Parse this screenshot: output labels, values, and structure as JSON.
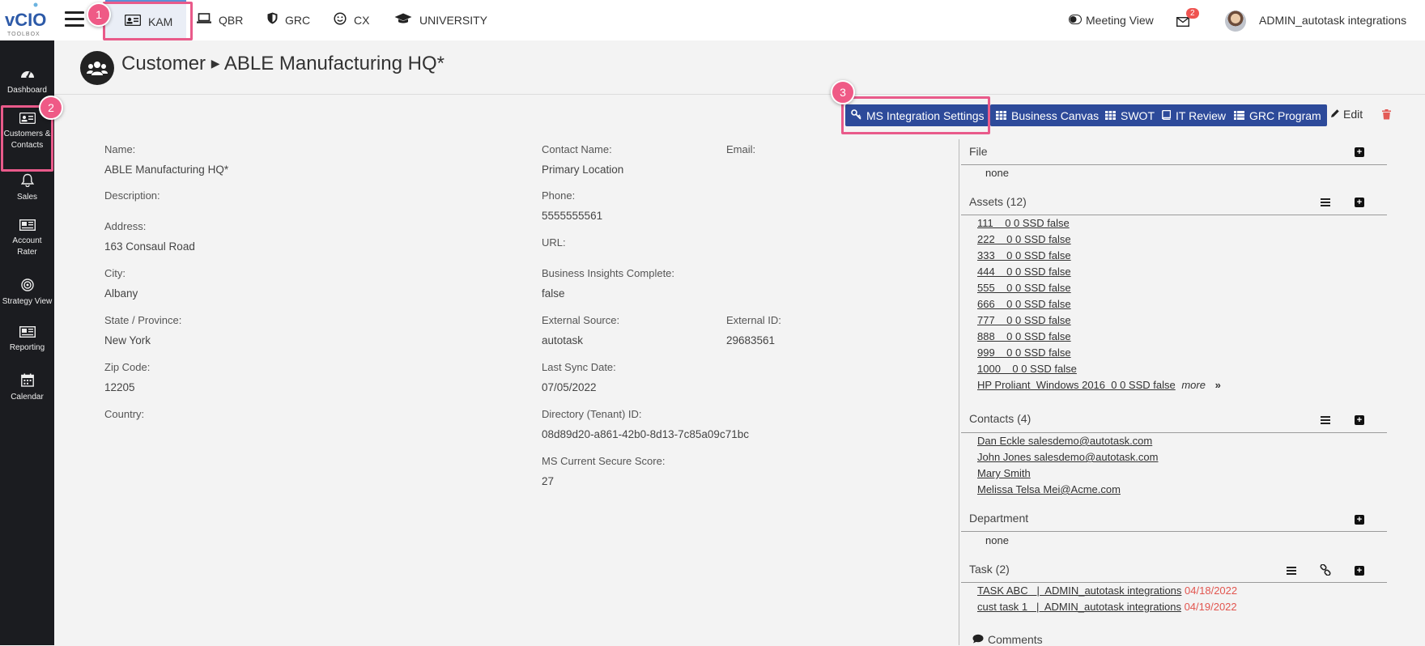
{
  "logo": {
    "brand": "vCIO",
    "sub": "TOOLBOX"
  },
  "nav": {
    "tabs": [
      {
        "label": "KAM",
        "icon": "id-card-icon"
      },
      {
        "label": "QBR",
        "icon": "laptop-icon"
      },
      {
        "label": "GRC",
        "icon": "shield-icon"
      },
      {
        "label": "CX",
        "icon": "smile-icon"
      },
      {
        "label": "UNIVERSITY",
        "icon": "graduation-cap-icon"
      }
    ],
    "meeting_view": "Meeting View",
    "mail_count": "2",
    "user_name": "ADMIN_autotask integrations"
  },
  "steps": [
    "1",
    "2",
    "3"
  ],
  "sidebar": {
    "items": [
      {
        "label": "Dashboard",
        "icon": "dashboard-icon"
      },
      {
        "label": "Customers & Contacts",
        "icon": "address-card-icon"
      },
      {
        "label": "Sales",
        "icon": "bell-icon"
      },
      {
        "label": "Account Rater",
        "icon": "newspaper-icon"
      },
      {
        "label": "Strategy View",
        "icon": "target-icon"
      },
      {
        "label": "Reporting",
        "icon": "report-icon"
      },
      {
        "label": "Calendar",
        "icon": "calendar-icon"
      }
    ]
  },
  "page": {
    "section": "Customer",
    "name": "ABLE Manufacturing HQ*"
  },
  "actions": {
    "ms_integration": "MS Integration Settings",
    "business_canvas": "Business Canvas",
    "swot": "SWOT",
    "it_review": "IT Review",
    "grc_program": "GRC Program",
    "edit": "Edit"
  },
  "details": {
    "name_label": "Name:",
    "name": "ABLE Manufacturing HQ*",
    "description_label": "Description:",
    "address_label": "Address:",
    "address": "163 Consaul Road",
    "city_label": "City:",
    "city": "Albany",
    "state_label": "State / Province:",
    "state": "New York",
    "zip_label": "Zip Code:",
    "zip": "12205",
    "country_label": "Country:",
    "contact_label": "Contact Name:",
    "contact": "Primary Location",
    "email_label": "Email:",
    "phone_label": "Phone:",
    "phone": "5555555561",
    "url_label": "URL:",
    "insights_label": "Business Insights Complete:",
    "insights": "false",
    "ext_source_label": "External Source:",
    "ext_source": "autotask",
    "ext_id_label": "External ID:",
    "ext_id": "29683561",
    "last_sync_label": "Last Sync Date:",
    "last_sync": "07/05/2022",
    "tenant_label": "Directory (Tenant) ID:",
    "tenant": "08d89d20-a861-42b0-8d13-7c85a09c71bc",
    "secure_label": "MS Current Secure Score:",
    "secure": "27"
  },
  "panel": {
    "file": {
      "title": "File",
      "empty": "none"
    },
    "assets": {
      "title": "Assets (12)",
      "items": [
        "111    0 0 SSD false",
        "222    0 0 SSD false",
        "333    0 0 SSD false",
        "444    0 0 SSD false",
        "555    0 0 SSD false",
        "666    0 0 SSD false",
        "777    0 0 SSD false",
        "888    0 0 SSD false",
        "999    0 0 SSD false",
        "1000    0 0 SSD false",
        "HP Proliant  Windows 2016  0 0 SSD false"
      ],
      "more": "more"
    },
    "contacts": {
      "title": "Contacts (4)",
      "items": [
        "Dan Eckle salesdemo@autotask.com",
        "John Jones salesdemo@autotask.com",
        "Mary Smith",
        "Melissa Telsa Mei@Acme.com"
      ]
    },
    "department": {
      "title": "Department",
      "empty": "none"
    },
    "tasks": {
      "title": "Task (2)",
      "items": [
        {
          "text": "TASK ABC   |  ADMIN_autotask integrations",
          "date": "04/18/2022"
        },
        {
          "text": "cust task 1   |  ADMIN_autotask integrations",
          "date": "04/19/2022"
        }
      ]
    },
    "comments": {
      "title": "Comments"
    }
  }
}
